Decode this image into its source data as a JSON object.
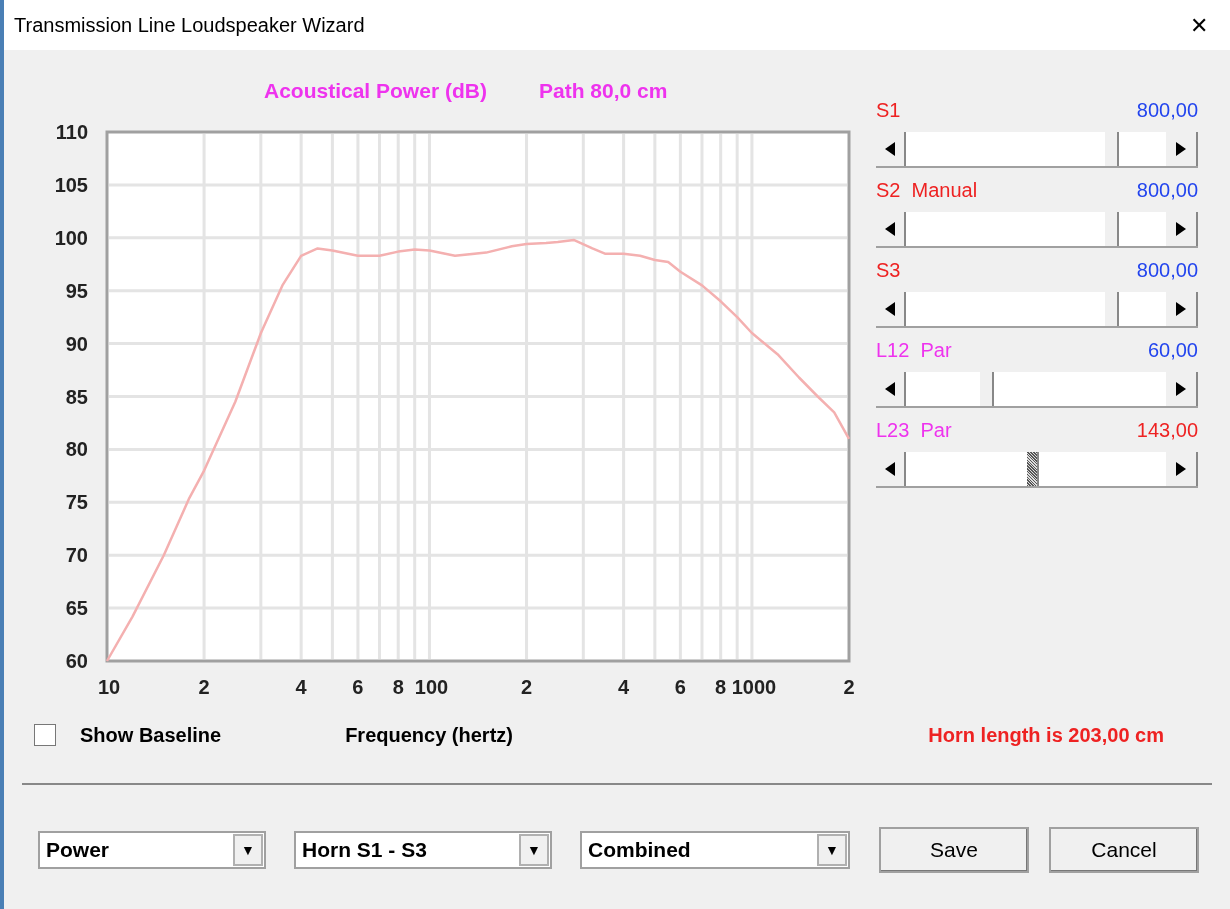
{
  "window": {
    "title": "Transmission Line Loudspeaker Wizard",
    "close": "✕"
  },
  "chart": {
    "title": "Acoustical Power (dB)",
    "subtitle": "Path 80,0 cm",
    "xlabel": "Frequency (hertz)",
    "y_axis_labels": [
      "110",
      "105",
      "100",
      "95",
      "90",
      "85",
      "80",
      "75",
      "70",
      "65",
      "60"
    ],
    "x_axis_labels": [
      "10",
      "2",
      "4",
      "6",
      "8",
      "100",
      "2",
      "4",
      "6",
      "8",
      "1000",
      "2"
    ]
  },
  "sliders": [
    {
      "label": {
        "text": "S1",
        "color": "#ee2222"
      },
      "value": {
        "text": "800,00",
        "color": "#2244ee"
      },
      "level": 0.81,
      "focused": false
    },
    {
      "label": {
        "text": "S2  Manual",
        "color": "#ee2222"
      },
      "value": {
        "text": "800,00",
        "color": "#2244ee"
      },
      "level": 0.81,
      "focused": false
    },
    {
      "label": {
        "text": "S3",
        "color": "#ee2222"
      },
      "value": {
        "text": "800,00",
        "color": "#2244ee"
      },
      "level": 0.81,
      "focused": false
    },
    {
      "label": {
        "text": "L12  Par",
        "color": "#ee33ee"
      },
      "value": {
        "text": "60,00",
        "color": "#2244ee"
      },
      "level": 0.3,
      "focused": false
    },
    {
      "label": {
        "text": "L23  Par",
        "color": "#ee33ee"
      },
      "value": {
        "text": "143,00",
        "color": "#ee2222"
      },
      "level": 0.49,
      "focused": true
    }
  ],
  "show_baseline": {
    "label": "Show Baseline",
    "checked": false
  },
  "horn_length": "Horn length is 203,00 cm",
  "dropdowns": [
    {
      "value": "Power",
      "arrow": "▼"
    },
    {
      "value": "Horn S1 - S3",
      "arrow": "▼"
    },
    {
      "value": "Combined",
      "arrow": "▼"
    }
  ],
  "buttons": [
    {
      "label": "Save"
    },
    {
      "label": "Cancel"
    }
  ]
}
